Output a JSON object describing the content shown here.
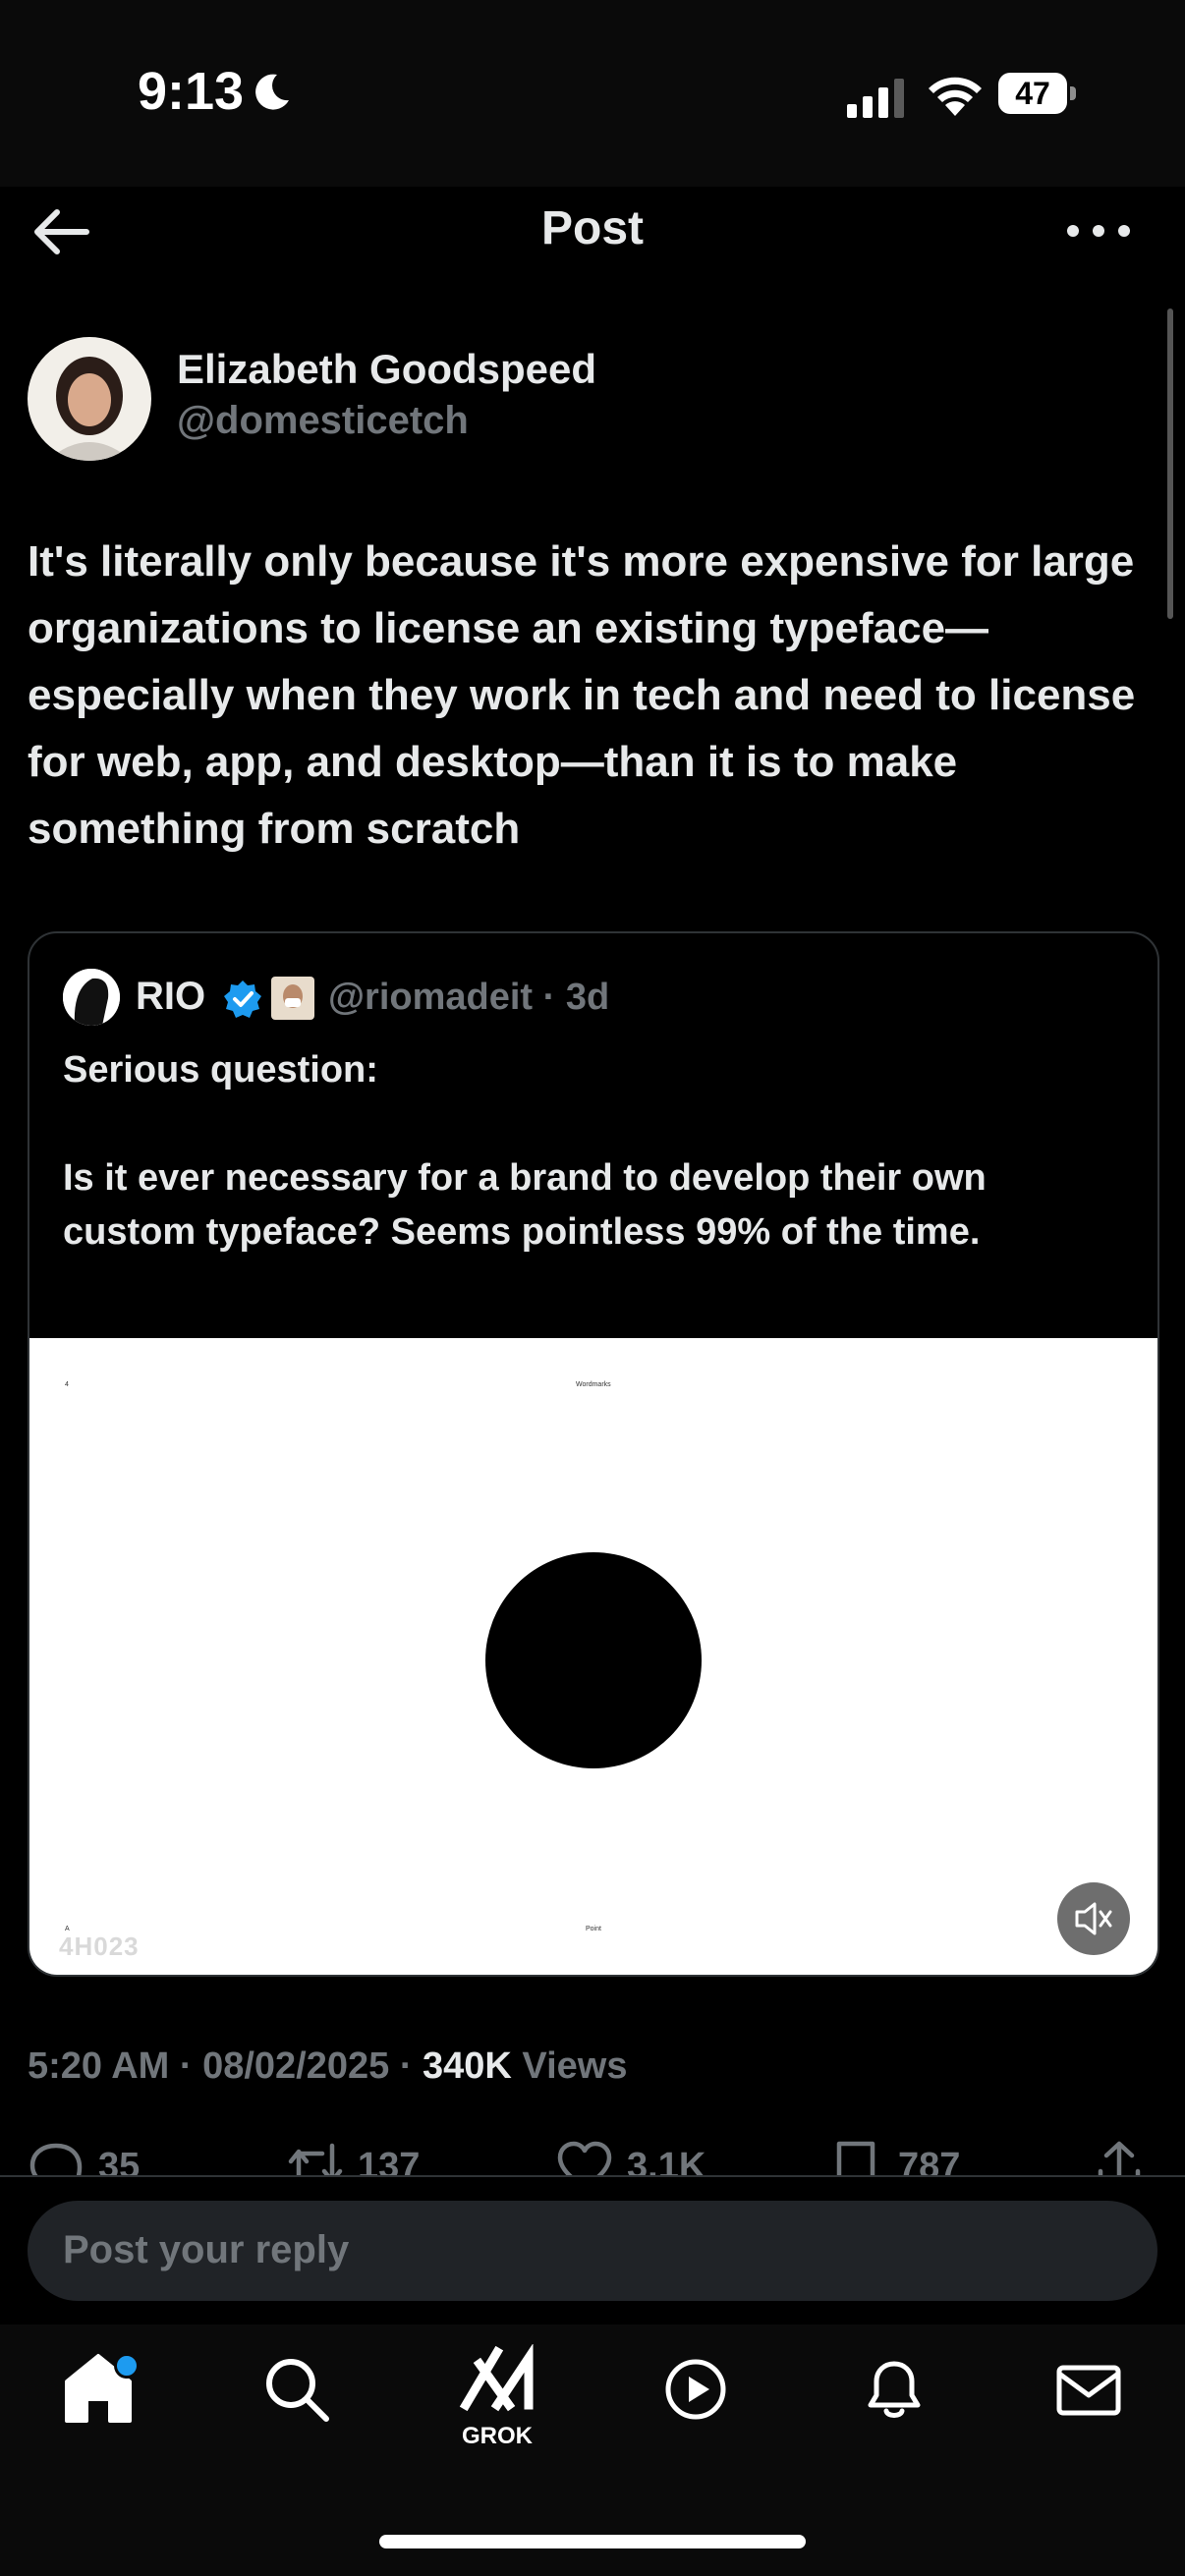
{
  "status_bar": {
    "time": "9:13",
    "battery": "47"
  },
  "header": {
    "title": "Post"
  },
  "author": {
    "name": "Elizabeth Goodspeed",
    "handle": "@domesticetch"
  },
  "post": {
    "text": "It's literally only because it's more expensive for large organizations to license an existing typeface—especially when they work in tech and need to license for web, app, and desktop—than it is to make something from scratch"
  },
  "quote": {
    "name": "RIO",
    "handle_time": "@riomadeit · 3d",
    "text": "Serious question:\n\nIs it ever necessary for a brand to develop their own custom typeface? Seems pointless 99% of the time.",
    "media": {
      "top_left": "4",
      "top_center": "Wordmarks",
      "bottom_left": "A",
      "bottom_center": "Point",
      "logo": "4H023"
    }
  },
  "meta": {
    "time_date": "5:20 AM · 08/02/2025 · ",
    "views_count": "340K",
    "views_label": " Views"
  },
  "actions": {
    "replies": "35",
    "reposts": "137",
    "likes": "3.1K",
    "bookmarks": "787"
  },
  "reply": {
    "placeholder": "Post your reply"
  },
  "tabs": {
    "grok_label": "GROK"
  },
  "colors": {
    "accent": "#1d9bf0",
    "background": "#000000",
    "muted": "#71767b",
    "text": "#e7e9ea"
  }
}
